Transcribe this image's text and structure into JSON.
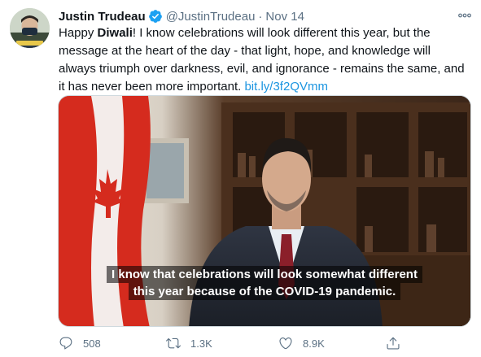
{
  "tweet": {
    "author_name": "Justin Trudeau",
    "handle": "@JustinTrudeau",
    "separator": "·",
    "date": "Nov 14",
    "text": {
      "part1": "Happy ",
      "bold": "Diwali",
      "part2": "! I know celebrations will look different this year, but the message at the heart of the day - that light, hope, and knowledge will always triumph over darkness, evil, and ignorance - remains the same, and it has never been more important. ",
      "link": "bit.ly/3f2QVmm"
    },
    "media": {
      "caption_line1": "I know that celebrations will look somewhat different",
      "caption_line2": "this year because of the COVID-19 pandemic."
    },
    "actions": {
      "reply_count": "508",
      "retweet_count": "1.3K",
      "like_count": "8.9K"
    }
  },
  "colors": {
    "text": "#0f1419",
    "secondary": "#5b7083",
    "link": "#1b95e0",
    "verified": "#1da1f2"
  },
  "icons": [
    "verified-badge-icon",
    "more-icon",
    "reply-icon",
    "retweet-icon",
    "like-icon",
    "share-icon"
  ]
}
